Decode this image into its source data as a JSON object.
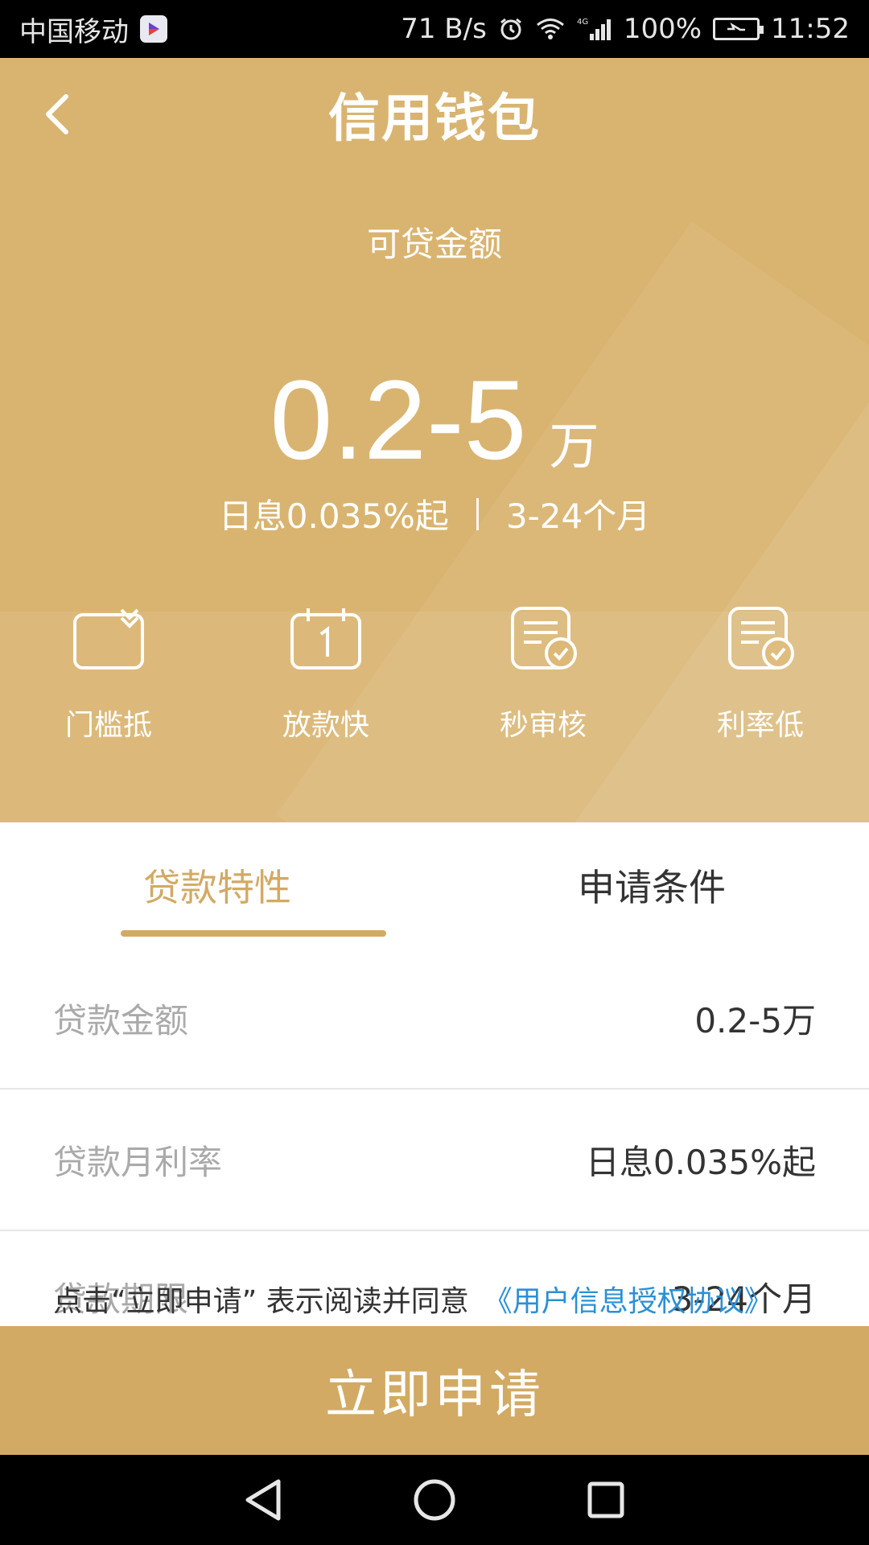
{
  "status_bar": {
    "carrier": "中国移动",
    "net_speed": "71 B/s",
    "network": "4G",
    "battery": "100%",
    "time": "11:52"
  },
  "header": {
    "title": "信用钱包"
  },
  "hero": {
    "amount_label": "可贷金额",
    "amount_value": "0.2-5",
    "amount_unit": "万",
    "daily_rate": "日息0.035%起",
    "term": "3-24个月"
  },
  "features": [
    {
      "label": "门槛抵",
      "icon": "inbox-check-icon"
    },
    {
      "label": "放款快",
      "icon": "calendar-icon"
    },
    {
      "label": "秒审核",
      "icon": "document-check-icon"
    },
    {
      "label": "利率低",
      "icon": "document-check-icon"
    }
  ],
  "tabs": [
    {
      "label": "贷款特性",
      "active": true
    },
    {
      "label": "申请条件",
      "active": false
    }
  ],
  "details": [
    {
      "label": "贷款金额",
      "value": "0.2-5万"
    },
    {
      "label": "贷款月利率",
      "value": "日息0.035%起"
    },
    {
      "label": "贷款期限",
      "value": "3-24个月"
    }
  ],
  "agreement": {
    "text": "点击“立即申请” 表示阅读并同意",
    "link": "《用户信息授权协议》"
  },
  "apply_button": {
    "label": "立即申请"
  },
  "colors": {
    "gold": "#d9b470",
    "accent": "#d2aa63",
    "link": "#2b8fd6"
  }
}
